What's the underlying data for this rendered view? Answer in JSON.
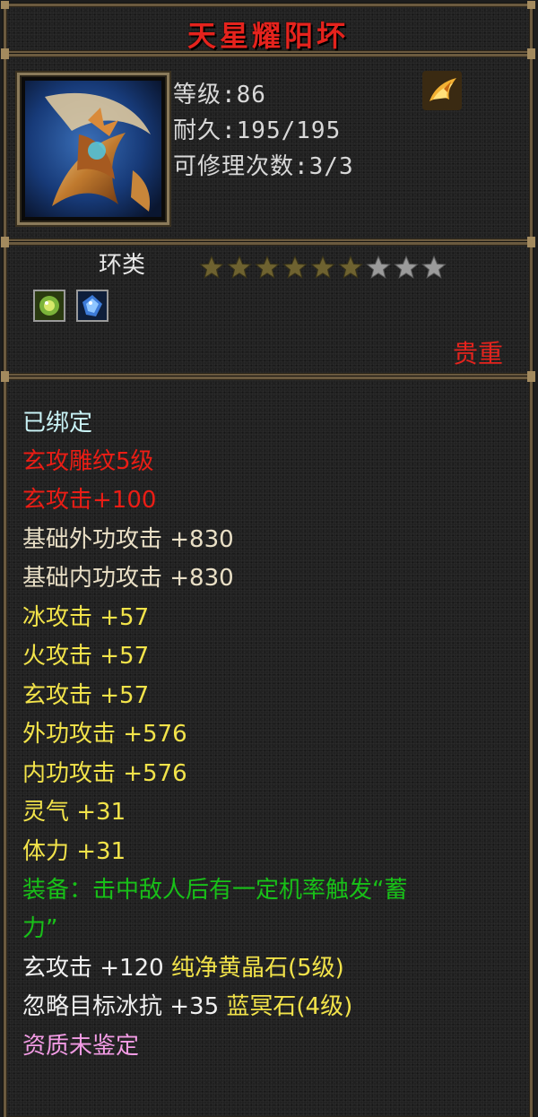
{
  "item": {
    "name": "天星耀阳坏",
    "level": "等级:86",
    "durability": "耐久:195/195",
    "repair": "可修理次数:3/3",
    "category": "环类",
    "stars_filled": 6,
    "stars_total": 9,
    "rarity": "贵重"
  },
  "gems": [
    {
      "icon": "green-gem-icon",
      "color": "#7bb33a"
    },
    {
      "icon": "blue-gem-icon",
      "color": "#3d7bd8"
    }
  ],
  "attributes": [
    {
      "text": "已绑定",
      "color": "cyan"
    },
    {
      "text": "玄攻雕纹5级",
      "color": "red"
    },
    {
      "text": "玄攻击+100",
      "color": "red"
    },
    {
      "text": "基础外功攻击 +830",
      "color": "cream"
    },
    {
      "text": "基础内功攻击 +830",
      "color": "cream"
    },
    {
      "text": "冰攻击 +57",
      "color": "yellow"
    },
    {
      "text": "火攻击 +57",
      "color": "yellow"
    },
    {
      "text": "玄攻击 +57",
      "color": "yellow"
    },
    {
      "text": "外功攻击 +576",
      "color": "yellow"
    },
    {
      "text": "内功攻击 +576",
      "color": "yellow"
    },
    {
      "text": "灵气 +31",
      "color": "yellow"
    },
    {
      "text": "体力 +31",
      "color": "yellow"
    },
    {
      "text": "装备：击中敌人后有一定机率触发“蓄",
      "color": "green"
    },
    {
      "text": "力”",
      "color": "green"
    },
    {
      "text_a": "玄攻击 +120 ",
      "text_b": "纯净黄晶石(5级)",
      "color": "mixed"
    },
    {
      "text_a": "忽略目标冰抗 +35 ",
      "text_b": "蓝冥石(4级)",
      "color": "mixed"
    },
    {
      "text": "资质未鉴定",
      "color": "pink"
    }
  ]
}
